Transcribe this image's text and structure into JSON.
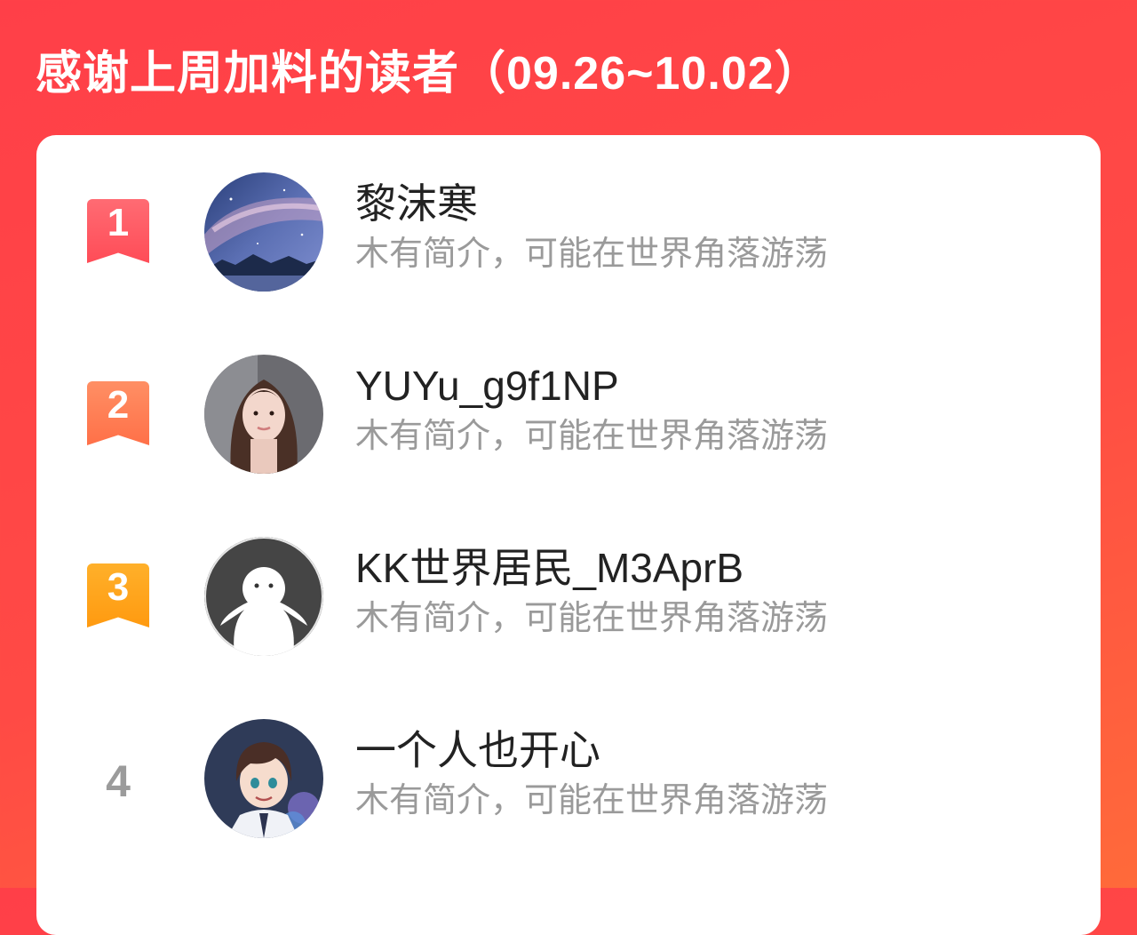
{
  "header": {
    "title": "感谢上周加料的读者（09.26~10.02）"
  },
  "readers": [
    {
      "rank": "1",
      "name": "黎沫寒",
      "bio": "木有简介，可能在世界角落游荡",
      "badge_color": "#ff5a62",
      "avatar": "starry-sky-avatar"
    },
    {
      "rank": "2",
      "name": "YUYu_g9f1NP",
      "bio": "木有简介，可能在世界角落游荡",
      "badge_color": "#ff7f55",
      "avatar": "photo-woman-avatar"
    },
    {
      "rank": "3",
      "name": "KK世界居民_M3AprB",
      "bio": "木有简介，可能在世界角落游荡",
      "badge_color": "#ffa116",
      "avatar": "default-ghost-avatar"
    },
    {
      "rank": "4",
      "name": "一个人也开心",
      "bio": "木有简介，可能在世界角落游荡",
      "avatar": "anime-boy-avatar"
    }
  ],
  "colors": {
    "background": "#ff4a45",
    "card": "#ffffff"
  }
}
